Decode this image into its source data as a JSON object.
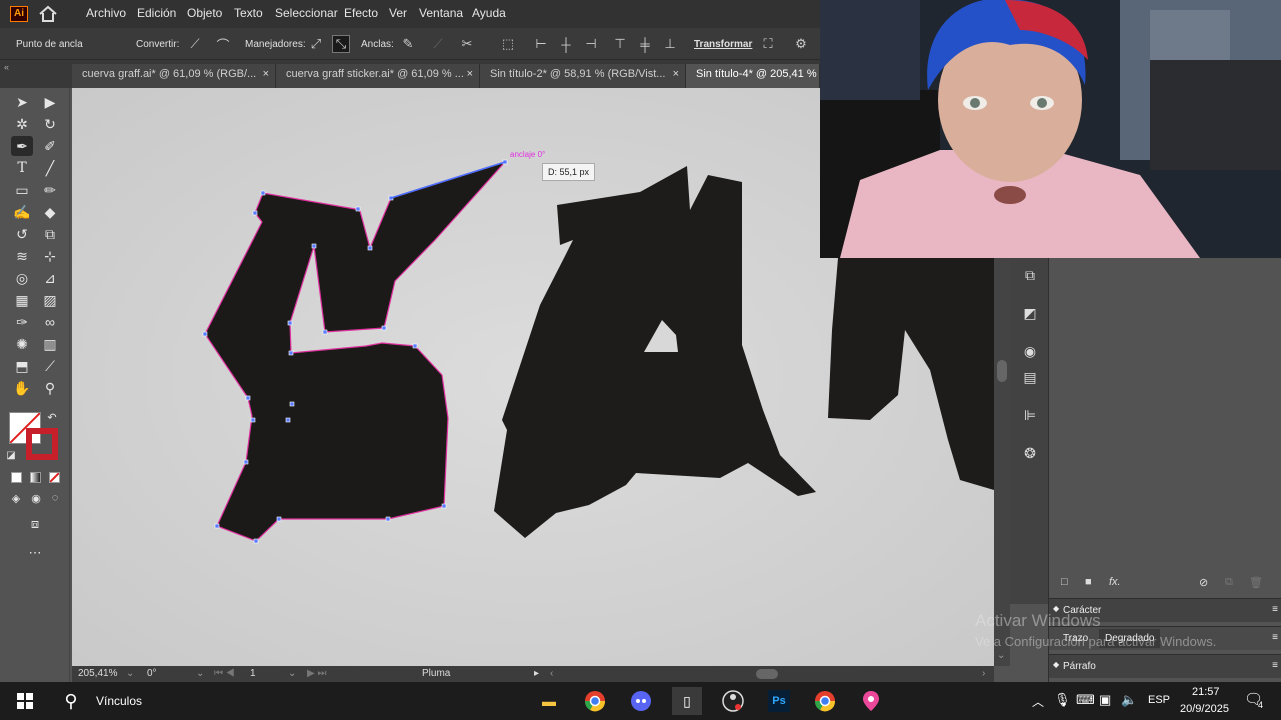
{
  "menubar": {
    "logo": "Ai",
    "items": [
      "Archivo",
      "Edición",
      "Objeto",
      "Texto",
      "Seleccionar",
      "Efecto",
      "Ver",
      "Ventana",
      "Ayuda"
    ]
  },
  "control": {
    "anchor_label": "Punto de ancla",
    "convert_label": "Convertir:",
    "handles_label": "Manejadores:",
    "anchors_label": "Anclas:",
    "transform_label": "Transformar"
  },
  "tabs": [
    {
      "label": "cuerva graff.ai* @ 61,09 % (RGB/...",
      "close": "×"
    },
    {
      "label": "cuerva graff sticker.ai* @ 61,09 % ...",
      "close": "×"
    },
    {
      "label": "Sin título-2* @ 58,91 % (RGB/Vist...",
      "close": "×"
    },
    {
      "label": "Sin título-4* @ 205,41 % (",
      "close": ""
    }
  ],
  "canvas": {
    "smart_guide": "anclaje 0°",
    "tooltip": "D: 55,1 px"
  },
  "status": {
    "zoom": "205,41%",
    "rotation": "0°",
    "artboard": "1",
    "tool": "Pluma"
  },
  "panels": {
    "character": "Carácter",
    "stroke": "Trazo",
    "gradient": "Degradado",
    "paragraph": "Párrafo"
  },
  "watermark": {
    "line1": "Activar Windows",
    "line2": "Ve a Configuración para activar Windows."
  },
  "taskbar": {
    "search_label": "Vínculos",
    "lang": "ESP",
    "time": "21:57",
    "date": "20/9/2025",
    "notif_count": "4"
  },
  "colors": {
    "accent": "#ff9a00",
    "path": "#e0309f",
    "anchor": "#4b6fff",
    "ink": "#1a1816"
  }
}
